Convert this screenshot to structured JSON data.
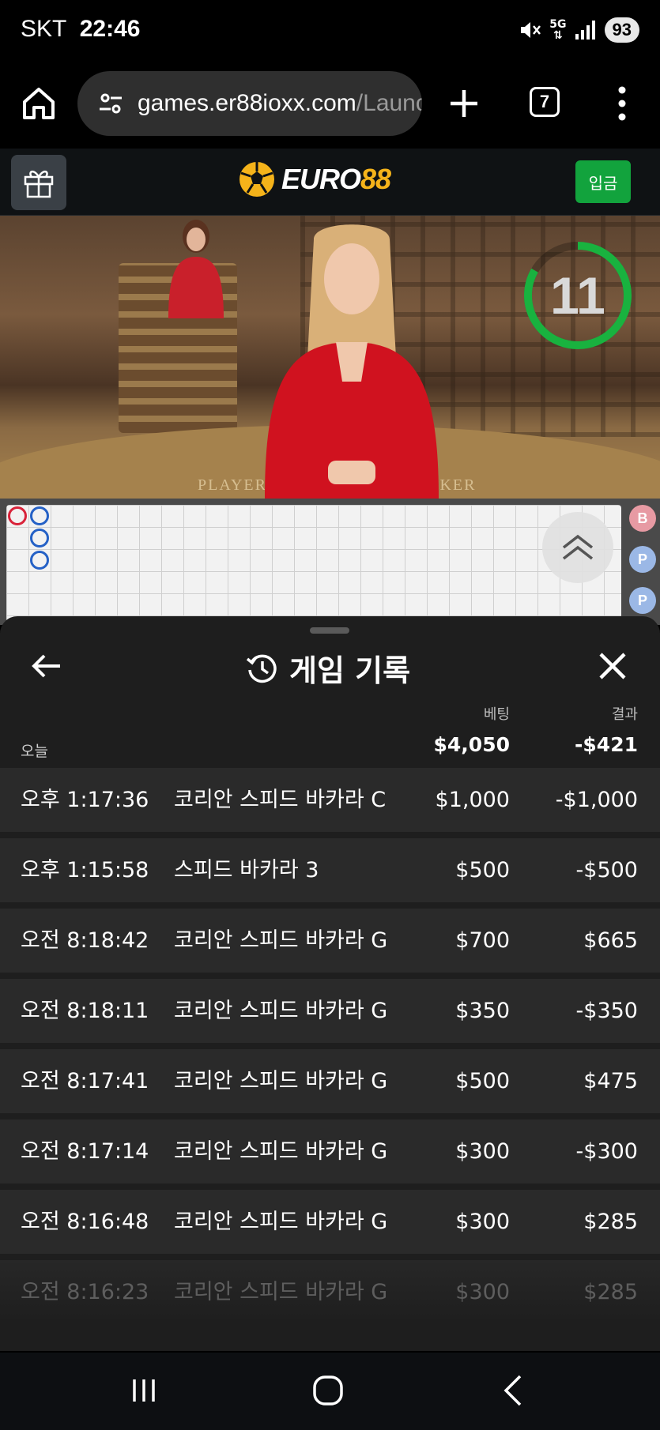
{
  "status_bar": {
    "carrier": "SKT",
    "time": "22:46",
    "network": "5G",
    "battery": "93"
  },
  "browser": {
    "url_main": "games.er88ioxx.com",
    "url_rest": "/Launc",
    "tab_count": "7"
  },
  "site": {
    "logo_prefix": "EURO",
    "logo_suffix": "88",
    "deposit_label": "입금",
    "brand_color": "#f5b31a",
    "deposit_color": "#12a33d"
  },
  "video": {
    "countdown": "11",
    "table_player": "PLAYER",
    "table_banker": "NKER"
  },
  "roadmap": {
    "side_pills": [
      "B",
      "P",
      "P"
    ]
  },
  "history": {
    "title": "게임 기록",
    "col_bet": "베팅",
    "col_result": "결과",
    "period_label": "오늘",
    "total_bet": "$4,050",
    "total_result": "-$421",
    "rows": [
      {
        "time": "오후 1:17:36",
        "game": "코리안 스피드 바카라 C",
        "bet": "$1,000",
        "result": "-$1,000"
      },
      {
        "time": "오후 1:15:58",
        "game": "스피드 바카라 3",
        "bet": "$500",
        "result": "-$500"
      },
      {
        "time": "오전 8:18:42",
        "game": "코리안 스피드 바카라 G",
        "bet": "$700",
        "result": "$665"
      },
      {
        "time": "오전 8:18:11",
        "game": "코리안 스피드 바카라 G",
        "bet": "$350",
        "result": "-$350"
      },
      {
        "time": "오전 8:17:41",
        "game": "코리안 스피드 바카라 G",
        "bet": "$500",
        "result": "$475"
      },
      {
        "time": "오전 8:17:14",
        "game": "코리안 스피드 바카라 G",
        "bet": "$300",
        "result": "-$300"
      },
      {
        "time": "오전 8:16:48",
        "game": "코리안 스피드 바카라 G",
        "bet": "$300",
        "result": "$285"
      },
      {
        "time": "오전 8:16:23",
        "game": "코리안 스피드 바카라 G",
        "bet": "$300",
        "result": "$285"
      }
    ]
  }
}
